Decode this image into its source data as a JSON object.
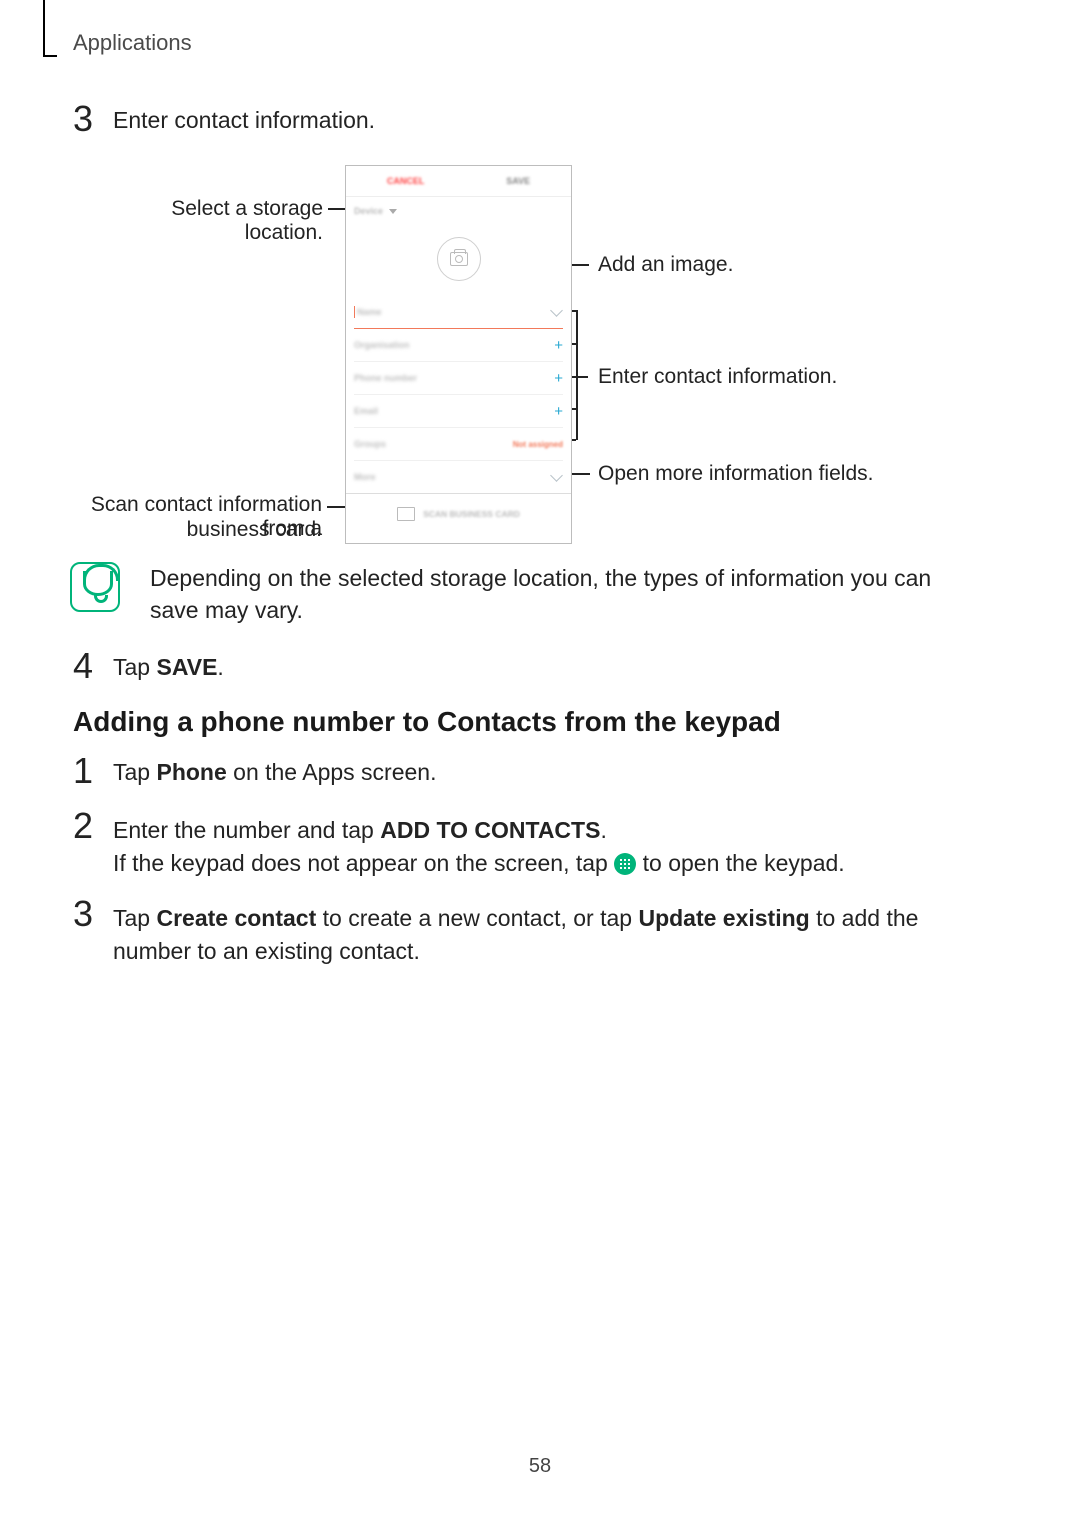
{
  "header": "Applications",
  "step3": {
    "num": "3",
    "text": "Enter contact information."
  },
  "callouts": {
    "storage": "Select a storage location.",
    "addImage": "Add an image.",
    "enterInfo": "Enter contact information.",
    "openMore": "Open more information fields.",
    "scanCard1": "Scan contact information from a",
    "scanCard2": "business card."
  },
  "phone": {
    "cancel": "CANCEL",
    "save": "SAVE",
    "storageChip": "Device",
    "fields": {
      "name": "Name",
      "organisation": "Organisation",
      "phone": "Phone number",
      "email": "Email",
      "groups": "Groups",
      "notAssigned": "Not assigned",
      "more": "More"
    },
    "scanButton": "SCAN BUSINESS CARD"
  },
  "note": "Depending on the selected storage location, the types of information you can save may vary.",
  "step4": {
    "num": "4",
    "pre": "Tap ",
    "bold": "SAVE",
    "post": "."
  },
  "heading": "Adding a phone number to Contacts from the keypad",
  "list": {
    "i1": {
      "num": "1",
      "pre": "Tap ",
      "bold": "Phone",
      "post": " on the Apps screen."
    },
    "i2": {
      "num": "2",
      "l1pre": "Enter the number and tap ",
      "l1bold": "ADD TO CONTACTS",
      "l1post": ".",
      "l2pre": "If the keypad does not appear on the screen, tap ",
      "l2post": " to open the keypad."
    },
    "i3": {
      "num": "3",
      "pre": "Tap ",
      "b1": "Create contact",
      "mid": " to create a new contact, or tap ",
      "b2": "Update existing",
      "post": " to add the number to an existing contact."
    }
  },
  "pageNumber": "58"
}
